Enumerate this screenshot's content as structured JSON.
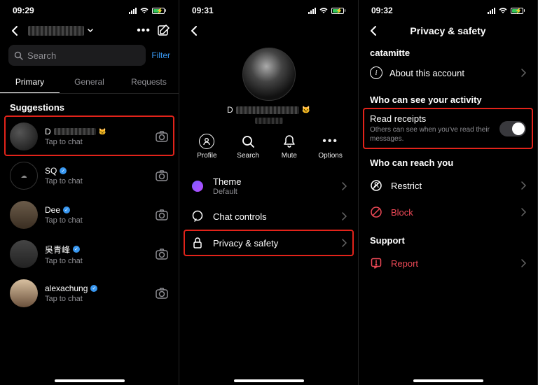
{
  "screen1": {
    "time": "09:29",
    "search_placeholder": "Search",
    "filter_label": "Filter",
    "tabs": {
      "primary": "Primary",
      "general": "General",
      "requests": "Requests"
    },
    "suggestions_label": "Suggestions",
    "items": [
      {
        "name": "D",
        "sub": "Tap to chat"
      },
      {
        "name": "SQ",
        "sub": "Tap to chat"
      },
      {
        "name": "Dee",
        "sub": "Tap to chat"
      },
      {
        "name": "吳青峰",
        "sub": "Tap to chat"
      },
      {
        "name": "alexachung",
        "sub": "Tap to chat"
      }
    ]
  },
  "screen2": {
    "time": "09:31",
    "actions": {
      "profile": "Profile",
      "search": "Search",
      "mute": "Mute",
      "options": "Options"
    },
    "menu": {
      "theme_label": "Theme",
      "theme_sub": "Default",
      "chat_controls": "Chat controls",
      "privacy_safety": "Privacy & safety"
    }
  },
  "screen3": {
    "time": "09:32",
    "title": "Privacy & safety",
    "account": "catamitte",
    "about": "About this account",
    "section_activity": "Who can see your activity",
    "read_receipts_title": "Read receipts",
    "read_receipts_sub": "Others can see when you've read their messages.",
    "section_reach": "Who can reach you",
    "restrict": "Restrict",
    "block": "Block",
    "section_support": "Support",
    "report": "Report"
  }
}
